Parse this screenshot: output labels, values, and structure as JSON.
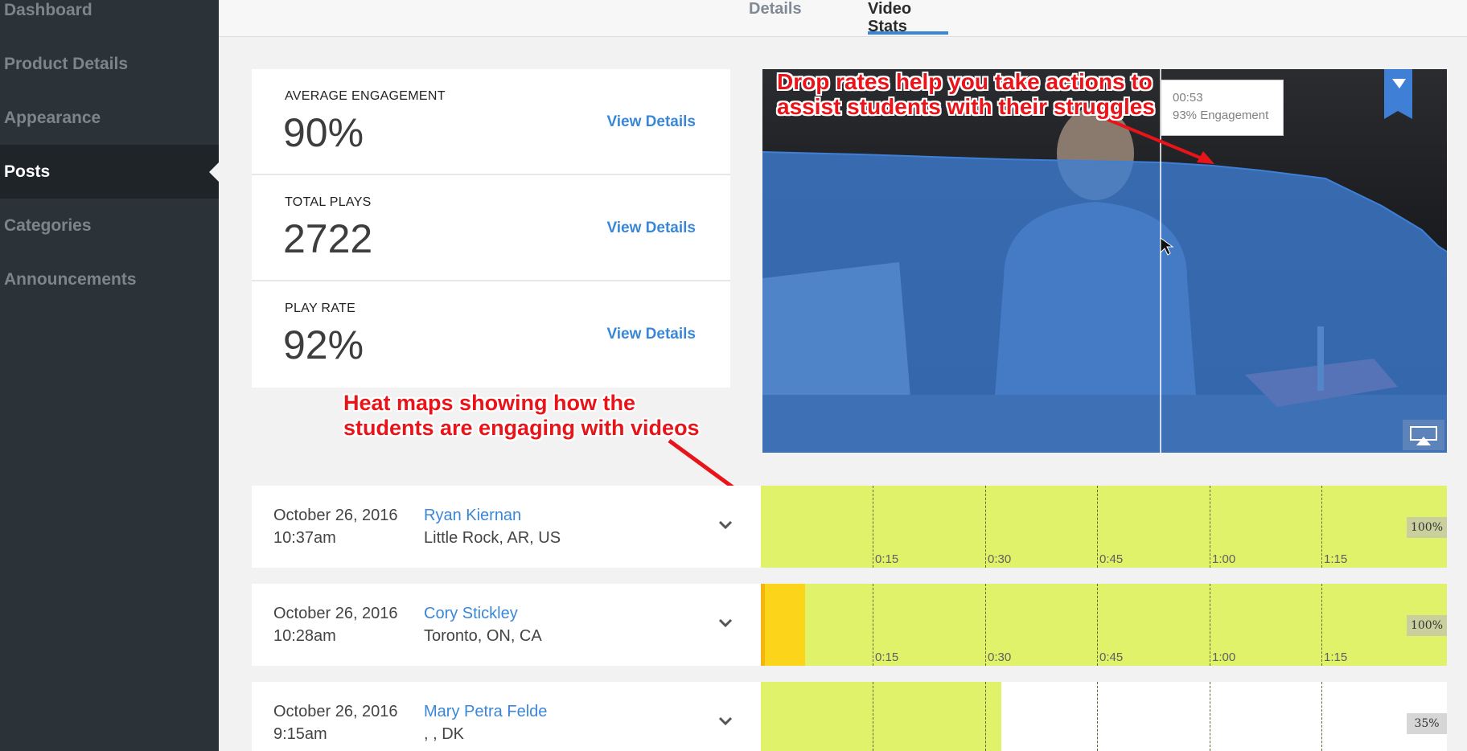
{
  "sidebar": {
    "items": [
      {
        "label": "Dashboard"
      },
      {
        "label": "Product Details"
      },
      {
        "label": "Appearance"
      },
      {
        "label": "Posts"
      },
      {
        "label": "Categories"
      },
      {
        "label": "Announcements"
      }
    ],
    "active": "Posts"
  },
  "tabs": [
    {
      "label": "Details"
    },
    {
      "label": "Video Stats"
    }
  ],
  "active_tab": "Video Stats",
  "stats": [
    {
      "label": "AVERAGE ENGAGEMENT",
      "value": "90%",
      "link": "View Details"
    },
    {
      "label": "TOTAL PLAYS",
      "value": "2722",
      "link": "View Details"
    },
    {
      "label": "PLAY RATE",
      "value": "92%",
      "link": "View Details"
    }
  ],
  "video": {
    "tooltip_time": "00:53",
    "tooltip_engagement": "93% Engagement",
    "engagement_fraction_at_marker": 0.93
  },
  "annotations": {
    "drop_rates_line1": "Drop rates help you take actions to",
    "drop_rates_line2": "assist students with their struggles",
    "heat_maps_line1": "Heat maps showing how the",
    "heat_maps_line2": "students are engaging with videos"
  },
  "heatmap_ticks": [
    "0:15",
    "0:30",
    "0:45",
    "1:00",
    "1:15"
  ],
  "sessions": [
    {
      "date": "October 26, 2016",
      "time": "10:37am",
      "name": "Ryan Kiernan",
      "location": "Little Rock, AR, US",
      "percent": "100%",
      "watched_fraction": 1.0
    },
    {
      "date": "October 26, 2016",
      "time": "10:28am",
      "name": "Cory Stickley",
      "location": "Toronto, ON, CA",
      "percent": "100%",
      "watched_fraction": 1.0
    },
    {
      "date": "October 26, 2016",
      "time": "9:15am",
      "name": "Mary Petra Felde",
      "location": ", , DK",
      "percent": "35%",
      "watched_fraction": 0.35
    }
  ],
  "colors": {
    "accent": "#3a87d8",
    "sidebar_bg": "#2b3238",
    "heat_green": "#dff26a",
    "heat_yellow": "#fcd41a",
    "overlay_red": "#e8141a",
    "engagement_blue": "#3f7fd6"
  }
}
